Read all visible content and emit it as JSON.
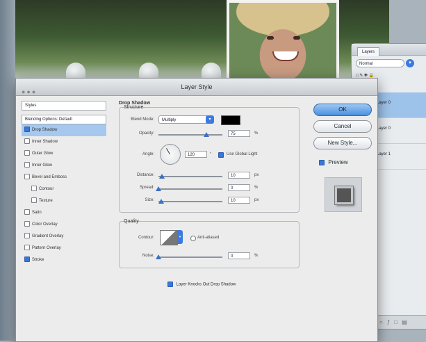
{
  "dialog": {
    "title": "Layer Style",
    "style_list": {
      "header": "Styles",
      "blending_options": "Blending Options: Default",
      "items": [
        {
          "label": "Drop Shadow",
          "checked": true,
          "selected": true,
          "indent": false
        },
        {
          "label": "Inner Shadow",
          "checked": false,
          "selected": false,
          "indent": false
        },
        {
          "label": "Outer Glow",
          "checked": false,
          "selected": false,
          "indent": false
        },
        {
          "label": "Inner Glow",
          "checked": false,
          "selected": false,
          "indent": false
        },
        {
          "label": "Bevel and Emboss",
          "checked": false,
          "selected": false,
          "indent": false
        },
        {
          "label": "Contour",
          "checked": false,
          "selected": false,
          "indent": true
        },
        {
          "label": "Texture",
          "checked": false,
          "selected": false,
          "indent": true
        },
        {
          "label": "Satin",
          "checked": false,
          "selected": false,
          "indent": false
        },
        {
          "label": "Color Overlay",
          "checked": false,
          "selected": false,
          "indent": false
        },
        {
          "label": "Gradient Overlay",
          "checked": false,
          "selected": false,
          "indent": false
        },
        {
          "label": "Pattern Overlay",
          "checked": false,
          "selected": false,
          "indent": false
        },
        {
          "label": "Stroke",
          "checked": true,
          "selected": false,
          "indent": false
        }
      ]
    },
    "drop_shadow": {
      "title": "Drop Shadow",
      "structure_title": "Structure",
      "blend_mode_label": "Blend Mode:",
      "blend_mode_value": "Multiply",
      "shadow_color": "#000000",
      "opacity_label": "Opacity:",
      "opacity_value": "75",
      "opacity_unit": "%",
      "opacity_level": 0.75,
      "angle_label": "Angle:",
      "angle_value": "120",
      "use_global_light_label": "Use Global Light",
      "use_global_light_checked": true,
      "distance_label": "Distance:",
      "distance_value": "10",
      "distance_unit": "px",
      "distance_level": 0.05,
      "spread_label": "Spread:",
      "spread_value": "0",
      "spread_unit": "%",
      "spread_level": 0.0,
      "size_label": "Size:",
      "size_value": "10",
      "size_unit": "px",
      "size_level": 0.04
    },
    "quality": {
      "title": "Quality",
      "contour_label": "Contour:",
      "anti_aliased_label": "Anti-aliased",
      "noise_label": "Noise:",
      "noise_value": "0",
      "noise_unit": "%",
      "noise_level": 0.0
    },
    "knockout_label": "Layer Knocks Out Drop Shadow",
    "knockout_checked": true,
    "buttons": {
      "ok": "OK",
      "cancel": "Cancel",
      "new_style": "New Style...",
      "preview": "Preview",
      "preview_checked": true
    }
  },
  "layers_panel": {
    "tab": "Layers",
    "blend_mode": "Normal",
    "rows": [
      {
        "name": "Layer 0",
        "selected": true
      },
      {
        "name": "Layer 0",
        "selected": false
      },
      {
        "name": "Layer 1",
        "selected": false
      }
    ]
  },
  "colors": {
    "accent": "#3c7ae0",
    "selection": "#a6c8ee",
    "dialog_bg": "#ececec"
  }
}
